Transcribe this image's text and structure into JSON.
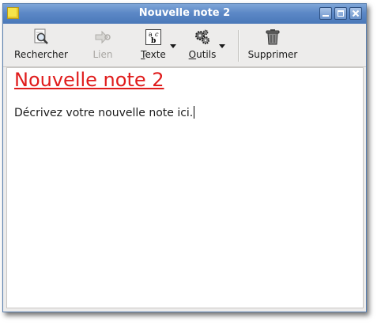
{
  "window": {
    "title": "Nouvelle note 2"
  },
  "toolbar": {
    "search_label": "Rechercher",
    "link_label": "Lien",
    "text_label_ul": "T",
    "text_label_rest": "exte",
    "tools_label_ul": "O",
    "tools_label_rest": "utils",
    "delete_label": "Supprimer",
    "text_icon_glyph_a": "a",
    "text_icon_glyph_c": "c",
    "text_icon_glyph_b": "b"
  },
  "note": {
    "title": "Nouvelle note 2",
    "body": "Décrivez votre nouvelle note ici."
  },
  "colors": {
    "title_link": "#e01b1b",
    "titlebar": "#5c88c6",
    "window_bg": "#edeceb"
  }
}
